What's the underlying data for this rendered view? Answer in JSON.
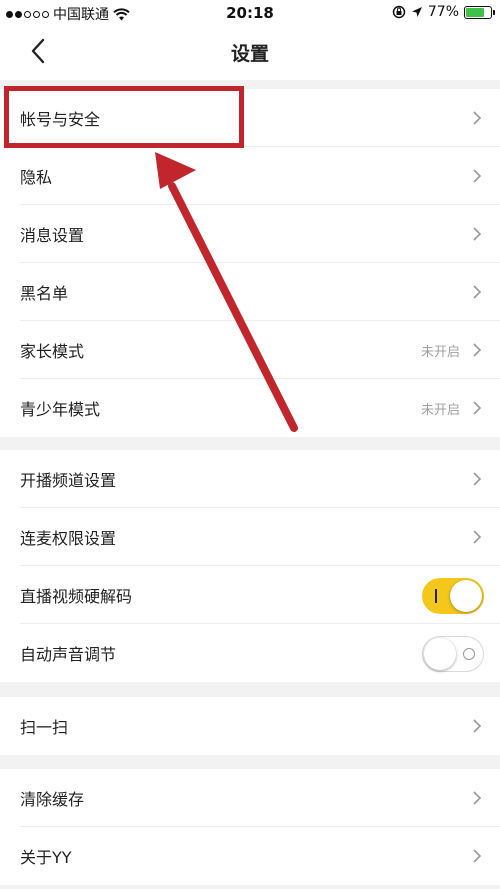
{
  "status_bar": {
    "carrier": "中国联通",
    "time": "20:18",
    "battery": "77%",
    "battery_level": 0.77
  },
  "nav": {
    "title": "设置",
    "back_icon": "chevron-left-icon"
  },
  "groups": [
    {
      "items": [
        {
          "label": "帐号与安全"
        },
        {
          "label": "隐私"
        },
        {
          "label": "消息设置"
        },
        {
          "label": "黑名单"
        },
        {
          "label": "家长模式",
          "status": "未开启"
        },
        {
          "label": "青少年模式",
          "status": "未开启"
        }
      ]
    },
    {
      "items": [
        {
          "label": "开播频道设置"
        },
        {
          "label": "连麦权限设置"
        },
        {
          "label": "直播视频硬解码",
          "toggle": true
        },
        {
          "label": "自动声音调节",
          "toggle": false
        }
      ]
    },
    {
      "items": [
        {
          "label": "扫一扫"
        }
      ]
    },
    {
      "items": [
        {
          "label": "清除缓存"
        },
        {
          "label": "关于YY"
        }
      ]
    }
  ],
  "colors": {
    "accent_toggle": "#f4c81a",
    "annotation": "#c0262b",
    "background": "#f2f2f2"
  }
}
